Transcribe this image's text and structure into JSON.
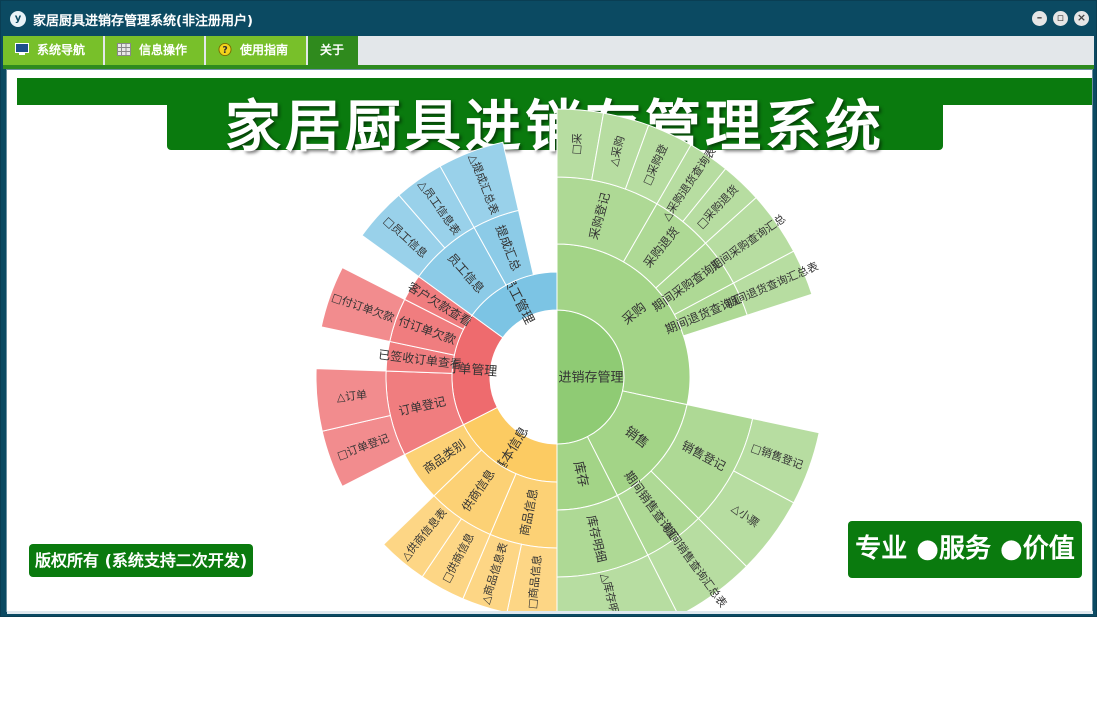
{
  "window": {
    "title": "家居厨具进销存管理系统(非注册用户)",
    "icon": "app-logo-icon",
    "controls": [
      "minimize-icon",
      "restore-icon",
      "close-icon"
    ]
  },
  "menu": {
    "tabs": [
      {
        "label": "系统导航",
        "icon": "monitor-icon"
      },
      {
        "label": "信息操作",
        "icon": "grid-icon"
      },
      {
        "label": "使用指南",
        "icon": "help-icon"
      },
      {
        "label": "关于",
        "icon": ""
      }
    ]
  },
  "banner": {
    "title": "家居厨具进销存管理系统"
  },
  "copyright": "版权所有 (系统支持二次开发)",
  "slogan": "专业 ●服务 ●价值",
  "colors": {
    "frame": "#0b4a62",
    "menu_green": "#78c02a",
    "menu_active": "#2f8a1d",
    "banner_green": "#0a7a0e",
    "purchase": "#a3d487",
    "sales": "#a3d487",
    "stock": "#a3d487",
    "base_info": "#fccb62",
    "orders": "#ee6b6e",
    "staff": "#7cc4e4"
  },
  "chart_data": {
    "type": "sunburst",
    "root": "进销存管理",
    "branches": [
      {
        "name": "采购",
        "color": "#a3d487",
        "start": 0,
        "end": 102,
        "children": [
          {
            "name": "采购登记",
            "start": 0,
            "end": 30,
            "children": [
              {
                "name": "□采",
                "start": 0,
                "end": 10
              },
              {
                "name": "△采购",
                "start": 10,
                "end": 20
              },
              {
                "name": "□采购登",
                "start": 20,
                "end": 30
              }
            ]
          },
          {
            "name": "采购退货",
            "start": 30,
            "end": 48,
            "children": [
              {
                "name": "△采购退货查询表",
                "start": 30,
                "end": 39
              },
              {
                "name": "□采购退货",
                "start": 39,
                "end": 48
              }
            ]
          },
          {
            "name": "期间采购查询汇总",
            "start": 48,
            "end": 62,
            "children": [
              {
                "name": "期间采购查询汇总",
                "start": 48,
                "end": 62
              }
            ]
          },
          {
            "name": "期间退货查询汇总",
            "start": 62,
            "end": 72,
            "children": [
              {
                "name": "期间退货查询汇总表",
                "start": 62,
                "end": 72
              }
            ]
          }
        ]
      },
      {
        "name": "销售",
        "color": "#a3d487",
        "start": 102,
        "end": 153,
        "children": [
          {
            "name": "销售登记",
            "start": 102,
            "end": 135,
            "children": [
              {
                "name": "□销售登记",
                "start": 102,
                "end": 118
              },
              {
                "name": "△小票",
                "start": 118,
                "end": 135
              }
            ]
          },
          {
            "name": "期间销售查询汇总",
            "start": 135,
            "end": 153,
            "children": [
              {
                "name": "期间销售查询汇总表",
                "start": 135,
                "end": 153
              }
            ]
          }
        ]
      },
      {
        "name": "库存",
        "color": "#a3d487",
        "start": 153,
        "end": 180,
        "children": [
          {
            "name": "库存明细",
            "start": 153,
            "end": 180,
            "children": [
              {
                "name": "△库存明细表",
                "start": 153,
                "end": 180
              }
            ]
          }
        ]
      },
      {
        "name": "基本信息",
        "color": "#fccb62",
        "start": 180,
        "end": 243,
        "children": [
          {
            "name": "商品信息",
            "start": 180,
            "end": 203,
            "children": [
              {
                "name": "□商品信息",
                "start": 180,
                "end": 192
              },
              {
                "name": "△商品信息表",
                "start": 192,
                "end": 203
              }
            ]
          },
          {
            "name": "供商信息",
            "start": 203,
            "end": 226,
            "children": [
              {
                "name": "□供商信息",
                "start": 203,
                "end": 214
              },
              {
                "name": "△供商信息表",
                "start": 214,
                "end": 226
              }
            ]
          },
          {
            "name": "商品类别",
            "start": 226,
            "end": 243,
            "children": []
          }
        ]
      },
      {
        "name": "订单管理",
        "color": "#ee6b6e",
        "start": 243,
        "end": 306,
        "children": [
          {
            "name": "订单登记",
            "start": 243,
            "end": 272,
            "children": [
              {
                "name": "□订单登记",
                "start": 243,
                "end": 257
              },
              {
                "name": "△订单",
                "start": 257,
                "end": 272
              }
            ]
          },
          {
            "name": "已签收订单查看",
            "start": 272,
            "end": 282,
            "children": []
          },
          {
            "name": "付订单欠款",
            "start": 282,
            "end": 297,
            "children": [
              {
                "name": "□付订单欠款",
                "start": 282,
                "end": 297
              }
            ]
          },
          {
            "name": "客户欠款查看",
            "start": 297,
            "end": 306,
            "children": []
          }
        ]
      },
      {
        "name": "员工管理",
        "color": "#7cc4e4",
        "start": 306,
        "end": 360,
        "children": [
          {
            "name": "员工信息",
            "start": 306,
            "end": 331,
            "children": [
              {
                "name": "□员工信息",
                "start": 306,
                "end": 319
              },
              {
                "name": "△员工信息表",
                "start": 319,
                "end": 331
              }
            ]
          },
          {
            "name": "提成汇总",
            "start": 331,
            "end": 347,
            "children": [
              {
                "name": "△提成汇总表",
                "start": 331,
                "end": 347
              }
            ]
          }
        ]
      }
    ]
  }
}
